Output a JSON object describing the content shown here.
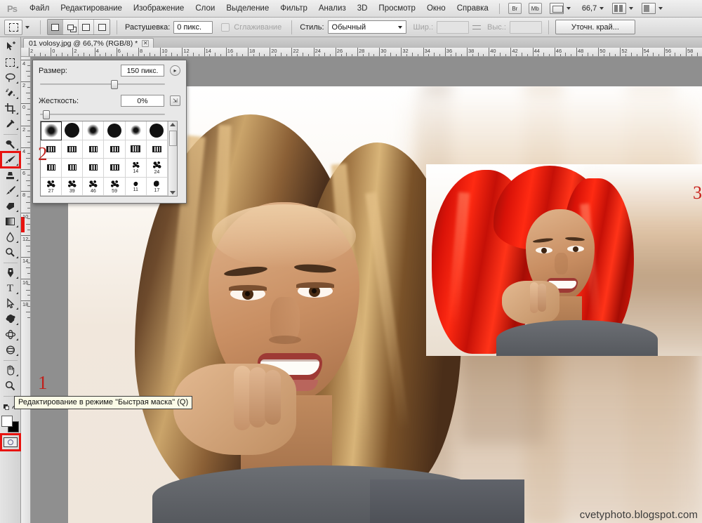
{
  "app": {
    "name": "Adobe Photoshop",
    "logo": "Ps"
  },
  "menubar": {
    "items": [
      {
        "label": "Файл"
      },
      {
        "label": "Редактирование"
      },
      {
        "label": "Изображение"
      },
      {
        "label": "Слои"
      },
      {
        "label": "Выделение"
      },
      {
        "label": "Фильтр"
      },
      {
        "label": "Анализ"
      },
      {
        "label": "3D"
      },
      {
        "label": "Просмотр"
      },
      {
        "label": "Окно"
      },
      {
        "label": "Справка"
      }
    ],
    "bridge_button": "Br",
    "minibridge_button": "Mb",
    "zoom_value": "66,7"
  },
  "options_bar": {
    "feather_label": "Растушевка:",
    "feather_value": "0 пикс.",
    "antialias_label": "Сглаживание",
    "style_label": "Стиль:",
    "style_value": "Обычный",
    "width_label": "Шир.:",
    "width_value": "",
    "height_label": "Выс.:",
    "height_value": "",
    "refine_edge_button": "Уточн. край..."
  },
  "document": {
    "tab_title": "01 volosy.jpg @ 66,7% (RGB/8) *",
    "close_glyph": "✕"
  },
  "toolbox": {
    "tools": [
      {
        "name": "move-tool",
        "glyph": "➤"
      },
      {
        "name": "rectangular-marquee-tool",
        "glyph": "▭"
      },
      {
        "name": "lasso-tool",
        "glyph": "◯"
      },
      {
        "name": "quick-selection-tool",
        "glyph": "✦"
      },
      {
        "name": "crop-tool",
        "glyph": "⌗"
      },
      {
        "name": "eyedropper-tool",
        "glyph": "✎"
      },
      {
        "name": "spot-healing-brush-tool",
        "glyph": "⌁"
      },
      {
        "name": "brush-tool",
        "glyph": "🖌"
      },
      {
        "name": "clone-stamp-tool",
        "glyph": "▬"
      },
      {
        "name": "history-brush-tool",
        "glyph": "✒"
      },
      {
        "name": "eraser-tool",
        "glyph": "▱"
      },
      {
        "name": "gradient-tool",
        "glyph": "▤"
      },
      {
        "name": "blur-tool",
        "glyph": "💧"
      },
      {
        "name": "dodge-tool",
        "glyph": "◔"
      },
      {
        "name": "pen-tool",
        "glyph": "✐"
      },
      {
        "name": "type-tool",
        "glyph": "T"
      },
      {
        "name": "path-selection-tool",
        "glyph": "➘"
      },
      {
        "name": "custom-shape-tool",
        "glyph": "❖"
      },
      {
        "name": "3d-rotate-tool",
        "glyph": "✺"
      },
      {
        "name": "3d-orbit-tool",
        "glyph": "◉"
      },
      {
        "name": "hand-tool",
        "glyph": "✋"
      },
      {
        "name": "zoom-tool",
        "glyph": "🔍"
      }
    ],
    "foreground_color": "#ffffff",
    "background_color": "#000000",
    "quick_mask_name": "quick-mask-button"
  },
  "brush_panel": {
    "size_label": "Размер:",
    "size_value": "150 пикс.",
    "hardness_label": "Жесткость:",
    "hardness_value": "0%",
    "size_slider_percent": 56,
    "hardness_slider_percent": 2,
    "presets": [
      {
        "kind": "soft",
        "d": 17,
        "label": ""
      },
      {
        "kind": "hard",
        "d": 21,
        "label": ""
      },
      {
        "kind": "soft",
        "d": 14,
        "label": ""
      },
      {
        "kind": "hard",
        "d": 20,
        "label": ""
      },
      {
        "kind": "soft",
        "d": 12,
        "label": ""
      },
      {
        "kind": "hard",
        "d": 20,
        "label": ""
      },
      {
        "kind": "tex",
        "d": 13,
        "label": ""
      },
      {
        "kind": "tex",
        "d": 13,
        "label": ""
      },
      {
        "kind": "tex",
        "d": 12,
        "label": ""
      },
      {
        "kind": "tex",
        "d": 13,
        "label": ""
      },
      {
        "kind": "tex",
        "d": 14,
        "label": ""
      },
      {
        "kind": "tex",
        "d": 13,
        "label": ""
      },
      {
        "kind": "tex",
        "d": 12,
        "label": ""
      },
      {
        "kind": "tex",
        "d": 12,
        "label": ""
      },
      {
        "kind": "tex",
        "d": 12,
        "label": ""
      },
      {
        "kind": "tex",
        "d": 13,
        "label": ""
      },
      {
        "kind": "spatter",
        "d": 11,
        "label": "14"
      },
      {
        "kind": "spatter",
        "d": 13,
        "label": "24"
      },
      {
        "kind": "spatter",
        "d": 13,
        "label": "27"
      },
      {
        "kind": "spatter",
        "d": 13,
        "label": "39"
      },
      {
        "kind": "spatter",
        "d": 13,
        "label": "46"
      },
      {
        "kind": "spatter",
        "d": 13,
        "label": "59"
      },
      {
        "kind": "leaf",
        "d": 9,
        "label": "11"
      },
      {
        "kind": "leaf",
        "d": 12,
        "label": "17"
      }
    ]
  },
  "rulers": {
    "unit": "cm",
    "horizontal_labels": [
      "2",
      "0",
      "2",
      "4",
      "6",
      "8",
      "10",
      "12",
      "14",
      "16",
      "18",
      "20",
      "22",
      "24",
      "26",
      "28",
      "30",
      "32",
      "34",
      "36",
      "38",
      "40",
      "42",
      "44",
      "46",
      "48",
      "50",
      "52",
      "54",
      "56",
      "58"
    ],
    "vertical_labels": [
      "4",
      "2",
      "0",
      "2",
      "4",
      "6",
      "8",
      "10",
      "12",
      "14",
      "16",
      "18"
    ]
  },
  "markers": [
    {
      "id": "1",
      "label": "1"
    },
    {
      "id": "2",
      "label": "2"
    },
    {
      "id": "3",
      "label": "3"
    }
  ],
  "tooltip": {
    "text": "Редактирование в режиме \"Быстрая маска\" (Q)"
  },
  "watermark": {
    "text": "cvetyphoto.blogspot.com"
  },
  "colors": {
    "marker_red": "#c0201b",
    "highlight_red": "#e8130f",
    "hair_red": "#e61a0c",
    "chrome": "#d6d6d6"
  }
}
